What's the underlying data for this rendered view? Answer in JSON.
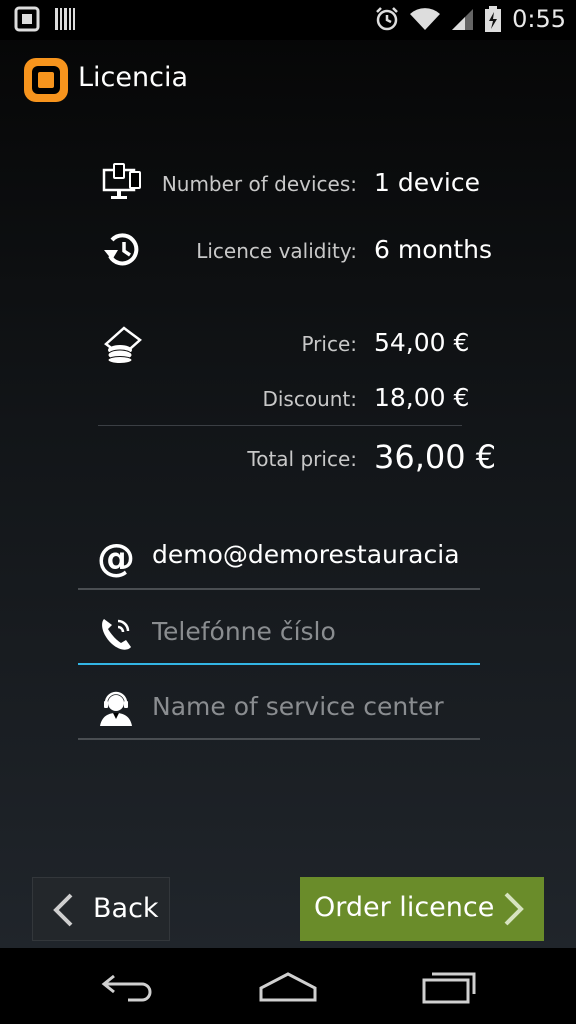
{
  "status_bar": {
    "time": "0:55",
    "icons": [
      "app-notification-icon",
      "barcode-icon",
      "alarm-icon",
      "wifi-icon",
      "cell-signal-icon",
      "battery-charging-icon"
    ]
  },
  "app_bar": {
    "title": "Licencia",
    "logo_icon": "app-logo-icon"
  },
  "licence": {
    "devices_label": "Number of devices:",
    "devices_value": "1 device",
    "validity_label": "Licence validity:",
    "validity_value": "6 months",
    "price_label": "Price:",
    "price_value": "54,00 €",
    "discount_label": "Discount:",
    "discount_value": "18,00 €",
    "total_label": "Total price:",
    "total_value": "36,00 €"
  },
  "form": {
    "email_value": "demo@demorestauracia",
    "phone_placeholder": "Telefónne číslo",
    "service_center_placeholder": "Name of service center"
  },
  "buttons": {
    "back_label": "Back",
    "order_label": "Order licence"
  },
  "colors": {
    "accent_blue": "#33b5e5",
    "order_green": "#6a8c2a",
    "logo_orange": "#f7941d"
  }
}
